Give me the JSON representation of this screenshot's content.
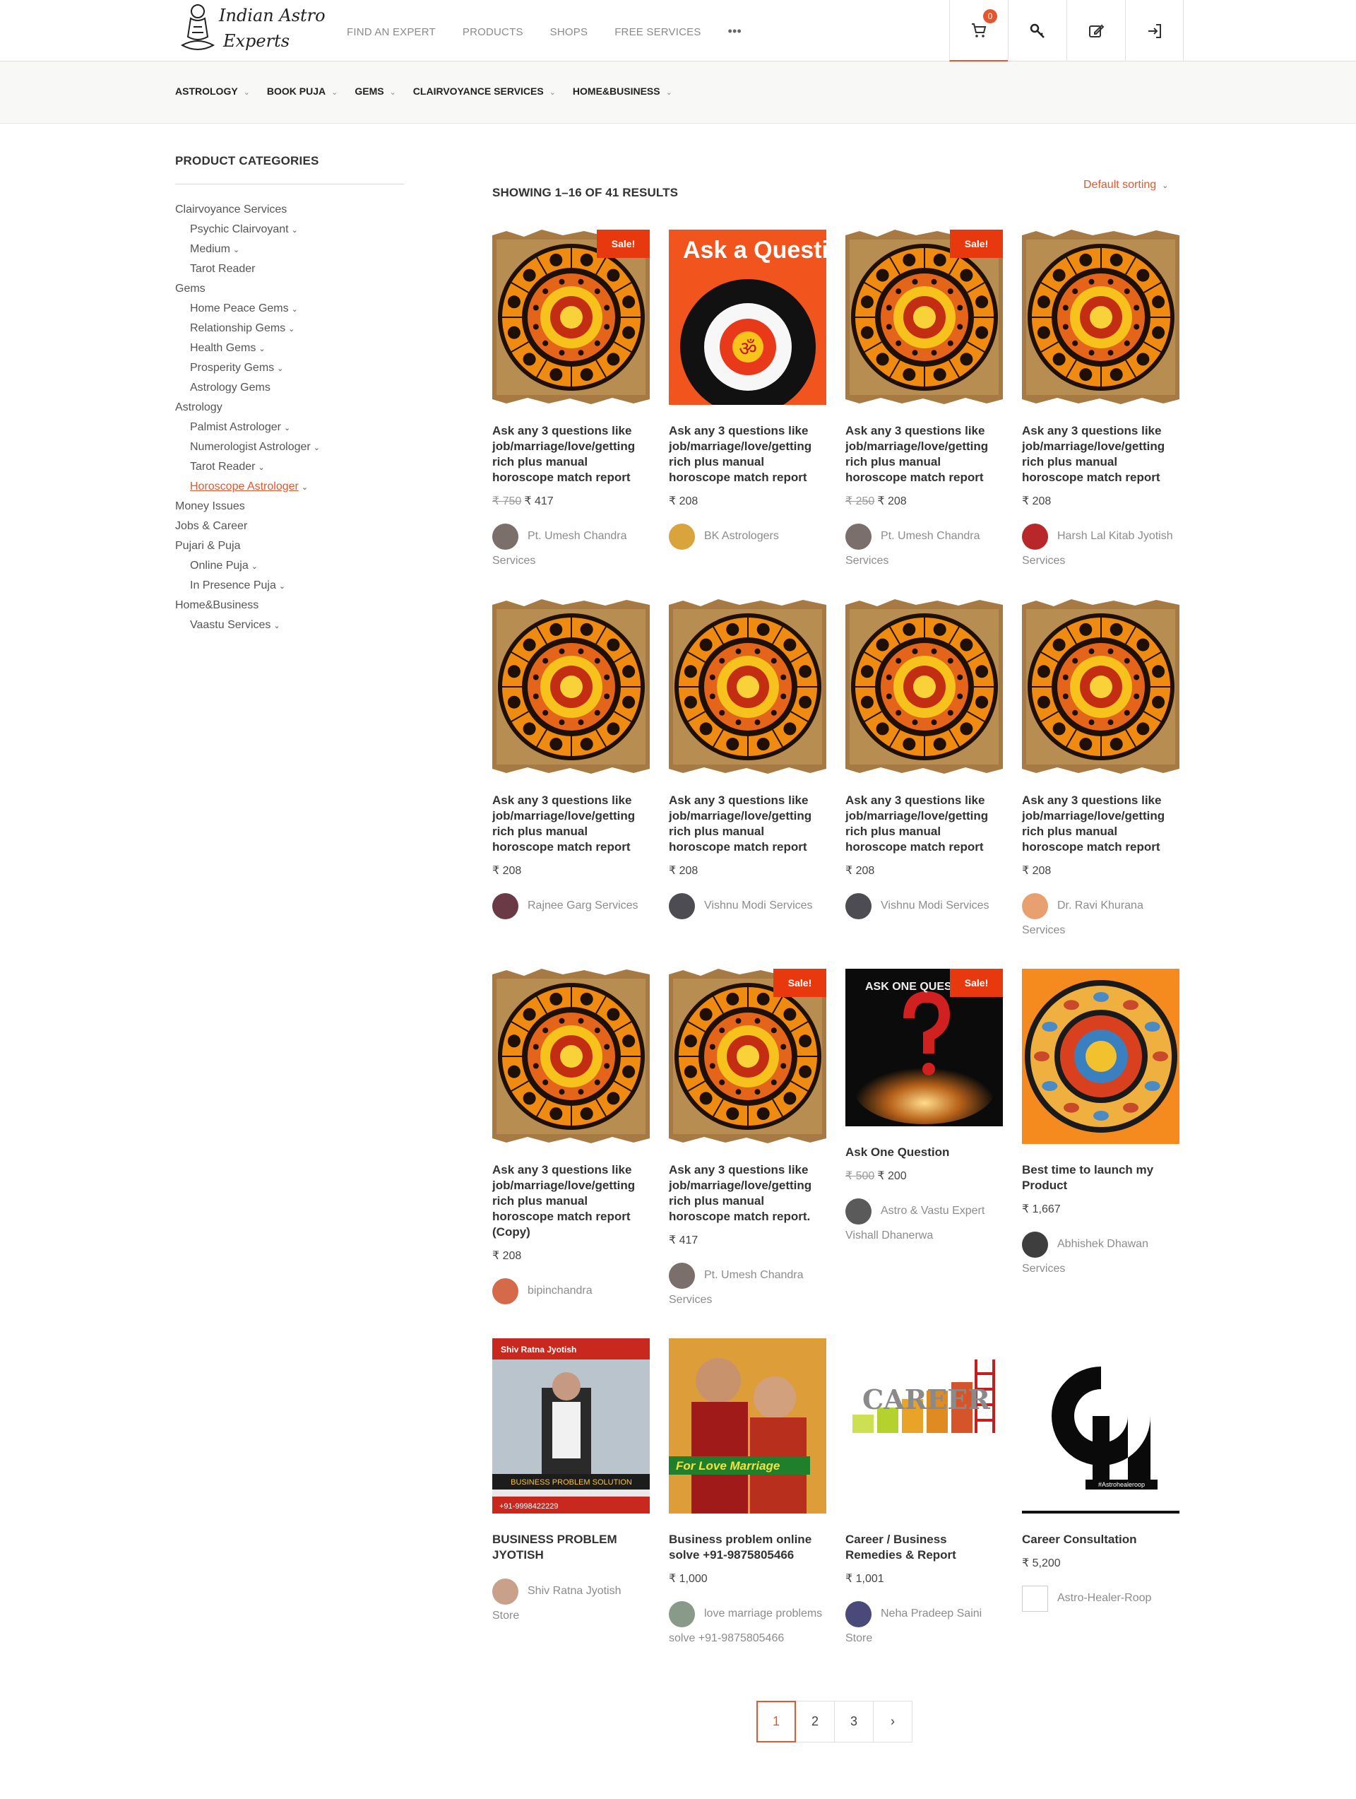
{
  "brand": {
    "logo_line1": "Indian Astro",
    "logo_line2": "Experts"
  },
  "topnav": [
    "FIND AN EXPERT",
    "PRODUCTS",
    "SHOPS",
    "FREE SERVICES"
  ],
  "cart_count": "0",
  "subnav": [
    "ASTROLOGY",
    "BOOK PUJA",
    "GEMS",
    "CLAIRVOYANCE SERVICES",
    "HOME&BUSINESS"
  ],
  "sidebar": {
    "title": "PRODUCT CATEGORIES",
    "items": [
      {
        "label": "Clairvoyance Services",
        "level": 0,
        "chev": false
      },
      {
        "label": "Psychic Clairvoyant",
        "level": 1,
        "chev": true
      },
      {
        "label": "Medium",
        "level": 1,
        "chev": true
      },
      {
        "label": "Tarot Reader",
        "level": 1,
        "chev": false
      },
      {
        "label": "Gems",
        "level": 0,
        "chev": false
      },
      {
        "label": "Home Peace Gems",
        "level": 1,
        "chev": true
      },
      {
        "label": "Relationship Gems",
        "level": 1,
        "chev": true
      },
      {
        "label": "Health Gems",
        "level": 1,
        "chev": true
      },
      {
        "label": "Prosperity Gems",
        "level": 1,
        "chev": true
      },
      {
        "label": "Astrology Gems",
        "level": 1,
        "chev": false
      },
      {
        "label": "Astrology",
        "level": 0,
        "chev": false
      },
      {
        "label": "Palmist Astrologer",
        "level": 1,
        "chev": true
      },
      {
        "label": "Numerologist Astrologer",
        "level": 1,
        "chev": true
      },
      {
        "label": "Tarot Reader",
        "level": 1,
        "chev": true
      },
      {
        "label": "Horoscope Astrologer",
        "level": 1,
        "chev": true,
        "active": true
      },
      {
        "label": "Money Issues",
        "level": 0,
        "chev": false
      },
      {
        "label": "Jobs & Career",
        "level": 0,
        "chev": false
      },
      {
        "label": "Pujari & Puja",
        "level": 0,
        "chev": false
      },
      {
        "label": "Online Puja",
        "level": 1,
        "chev": true
      },
      {
        "label": "In Presence Puja",
        "level": 1,
        "chev": true
      },
      {
        "label": "Home&Business",
        "level": 0,
        "chev": false
      },
      {
        "label": "Vaastu Services",
        "level": 1,
        "chev": true
      }
    ]
  },
  "results_text": "SHOWING 1–16 OF 41 RESULTS",
  "sorting": "Default sorting",
  "sale_label": "Sale!",
  "products": [
    {
      "title": "Ask any 3 questions like job/marriage/love/getting rich plus manual horoscope match report",
      "old_price": "₹ 750",
      "price": "₹ 417",
      "seller": "Pt. Umesh Chandra Services",
      "sale": true,
      "img": "zodiac",
      "avatar": "#7a6f6a"
    },
    {
      "title": "Ask any 3 questions like job/marriage/love/getting rich plus manual horoscope match report",
      "old_price": "",
      "price": "₹ 208",
      "seller": "BK Astrologers",
      "sale": false,
      "img": "question",
      "avatar": "#d9a43c"
    },
    {
      "title": "Ask any 3 questions like job/marriage/love/getting rich plus manual horoscope match report",
      "old_price": "₹ 250",
      "price": "₹ 208",
      "seller": "Pt. Umesh Chandra Services",
      "sale": true,
      "img": "zodiac",
      "avatar": "#7a6f6a"
    },
    {
      "title": "Ask any 3 questions like job/marriage/love/getting rich plus manual horoscope match report",
      "old_price": "",
      "price": "₹ 208",
      "seller": "Harsh Lal Kitab Jyotish Services",
      "sale": false,
      "img": "zodiac",
      "avatar": "#b8282a"
    },
    {
      "title": "Ask any 3 questions like job/marriage/love/getting rich plus manual horoscope match report",
      "old_price": "",
      "price": "₹ 208",
      "seller": "Rajnee Garg Services",
      "sale": false,
      "img": "zodiac",
      "avatar": "#6b3a47"
    },
    {
      "title": "Ask any 3 questions like job/marriage/love/getting rich plus manual horoscope match report",
      "old_price": "",
      "price": "₹ 208",
      "seller": "Vishnu Modi Services",
      "sale": false,
      "img": "zodiac",
      "avatar": "#4c4c52"
    },
    {
      "title": "Ask any 3 questions like job/marriage/love/getting rich plus manual horoscope match report",
      "old_price": "",
      "price": "₹ 208",
      "seller": "Vishnu Modi Services",
      "sale": false,
      "img": "zodiac",
      "avatar": "#4c4c52"
    },
    {
      "title": "Ask any 3 questions like job/marriage/love/getting rich plus manual horoscope match report",
      "old_price": "",
      "price": "₹ 208",
      "seller": "Dr. Ravi Khurana Services",
      "sale": false,
      "img": "zodiac",
      "avatar": "#e8a070"
    },
    {
      "title": "Ask any 3 questions like job/marriage/love/getting rich plus manual horoscope match report (Copy)",
      "old_price": "",
      "price": "₹ 208",
      "seller": "bipinchandra",
      "sale": false,
      "img": "zodiac",
      "avatar": "#d46a4a"
    },
    {
      "title": "Ask any 3 questions like job/marriage/love/getting rich plus manual horoscope match report.",
      "old_price": "",
      "price": "₹ 417",
      "seller": "Pt. Umesh Chandra Services",
      "sale": true,
      "img": "zodiac",
      "avatar": "#7a6f6a"
    },
    {
      "title": "Ask One Question",
      "old_price": "₹ 500",
      "price": "₹ 200",
      "seller": "Astro & Vastu Expert Vishall Dhanerwa",
      "sale": true,
      "img": "askone",
      "avatar": "#5a5a5a"
    },
    {
      "title": "Best time to launch my Product",
      "old_price": "",
      "price": "₹ 1,667",
      "seller": "Abhishek Dhawan Services",
      "sale": false,
      "img": "wheel",
      "avatar": "#3e3e3e"
    },
    {
      "title": "BUSINESS PROBLEM JYOTISH",
      "old_price": "",
      "price": "",
      "seller": "Shiv Ratna Jyotish Store",
      "sale": false,
      "img": "business",
      "avatar": "#c9a08a"
    },
    {
      "title": "Business problem online solve +91-9875805466",
      "old_price": "",
      "price": "₹ 1,000",
      "seller": "love marriage problems solve +91-9875805466",
      "sale": false,
      "img": "marriage",
      "avatar": "#8a9a8a"
    },
    {
      "title": "Career / Business Remedies & Report",
      "old_price": "",
      "price": "₹ 1,001",
      "seller": "Neha Pradeep Saini Store",
      "sale": false,
      "img": "career",
      "avatar": "#4a4a7a"
    },
    {
      "title": "Career Consultation",
      "old_price": "",
      "price": "₹ 5,200",
      "seller": "Astro-Healer-Roop",
      "sale": false,
      "img": "logoA",
      "avatar": "#ffffff"
    }
  ],
  "image_text": {
    "question": "Ask a Question",
    "askone": "ASK ONE QUES",
    "business_header": "Shiv Ratna Jyotish",
    "business_banner": "BUSINESS PROBLEM SOLUTION",
    "business_phone": "+91-9998422229",
    "marriage_banner": "For Love Marriage",
    "career": "CAREER",
    "logoA_caption": "#Astrohealeroop"
  },
  "pagination": [
    "1",
    "2",
    "3",
    "›"
  ]
}
